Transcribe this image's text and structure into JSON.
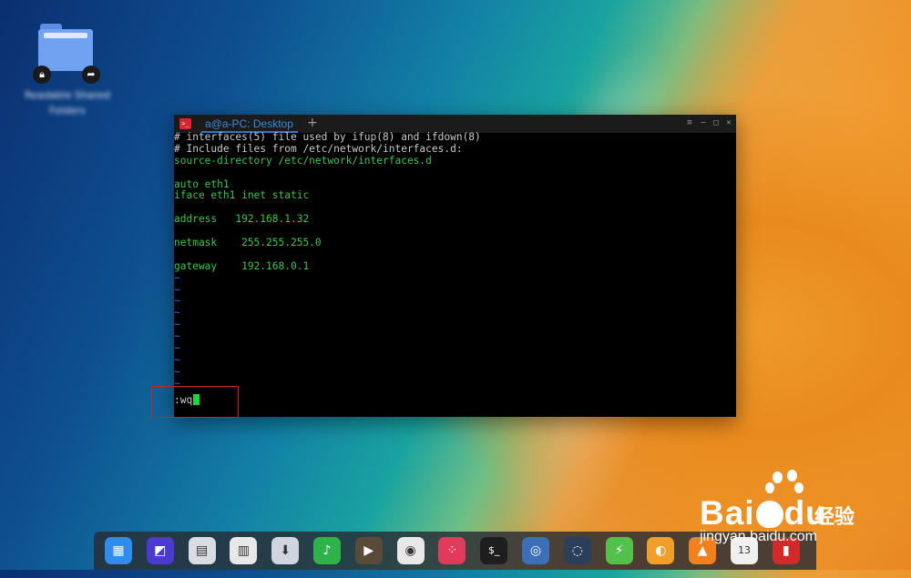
{
  "desktop": {
    "icon_label": "Readable Shared Folders"
  },
  "terminal": {
    "title": "a@a-PC: Desktop",
    "new_tab": "+",
    "win_menu": "≡",
    "win_min": "—",
    "win_max": "□",
    "win_close": "✕",
    "app_icon_glyph": ">_",
    "lines": [
      {
        "text": "# interfaces(5) file used by ifup(8) and ifdown(8)",
        "style": "comment"
      },
      {
        "text": "# Include files from /etc/network/interfaces.d:",
        "style": "comment"
      },
      {
        "text": "source-directory /etc/network/interfaces.d",
        "style": "green"
      },
      {
        "text": "",
        "style": "green"
      },
      {
        "text": "auto eth1",
        "style": "green"
      },
      {
        "text": "iface eth1 inet static",
        "style": "green"
      },
      {
        "text": "",
        "style": "green"
      },
      {
        "text": "address   192.168.1.32",
        "style": "green"
      },
      {
        "text": "",
        "style": "green"
      },
      {
        "text": "netmask    255.255.255.0",
        "style": "green"
      },
      {
        "text": "",
        "style": "green"
      },
      {
        "text": "gateway    192.168.0.1",
        "style": "green"
      },
      {
        "text": "~",
        "style": "tilde"
      },
      {
        "text": "~",
        "style": "tilde"
      },
      {
        "text": "~",
        "style": "tilde"
      },
      {
        "text": "~",
        "style": "tilde"
      },
      {
        "text": "~",
        "style": "tilde"
      },
      {
        "text": "~",
        "style": "tilde"
      },
      {
        "text": "~",
        "style": "tilde"
      },
      {
        "text": "~",
        "style": "tilde"
      },
      {
        "text": "~",
        "style": "tilde"
      },
      {
        "text": "~",
        "style": "tilde"
      }
    ],
    "command": ":wq"
  },
  "dock": {
    "items": [
      {
        "name": "launcher-icon",
        "glyph": "▦",
        "bg": "#2f8df0"
      },
      {
        "name": "multitasking-icon",
        "glyph": "◩",
        "bg": "#4a3ad0"
      },
      {
        "name": "file-manager-icon",
        "glyph": "▤",
        "bg": "#d8dde4"
      },
      {
        "name": "archive-manager-icon",
        "glyph": "▥",
        "bg": "#e8e8e8"
      },
      {
        "name": "app-store-icon",
        "glyph": "⬇",
        "bg": "#cfd6df"
      },
      {
        "name": "music-icon",
        "glyph": "♪",
        "bg": "#2fb24a"
      },
      {
        "name": "video-icon",
        "glyph": "▶",
        "bg": "#5a4a3a"
      },
      {
        "name": "chrome-icon",
        "glyph": "◉",
        "bg": "#e8e8e8"
      },
      {
        "name": "dice-app-icon",
        "glyph": "⁘",
        "bg": "#e23a5a"
      },
      {
        "name": "terminal-icon",
        "glyph": "$_",
        "bg": "#1e1e1e"
      },
      {
        "name": "screenshot-icon",
        "glyph": "◎",
        "bg": "#3b6fb8"
      },
      {
        "name": "browser-icon",
        "glyph": "◌",
        "bg": "#2c3f5a"
      },
      {
        "name": "thunder-icon",
        "glyph": "⚡",
        "bg": "#53c04a"
      },
      {
        "name": "sync-icon",
        "glyph": "◐",
        "bg": "#f0a02a"
      },
      {
        "name": "vlc-icon",
        "glyph": "▲",
        "bg": "#f08020"
      },
      {
        "name": "clock-icon",
        "glyph": "13",
        "bg": "#f0f0f0"
      },
      {
        "name": "trash-icon",
        "glyph": "▮",
        "bg": "#d02a2a"
      }
    ]
  },
  "watermark": {
    "brand": "Bai",
    "brand_tail": "du",
    "brand_cn": "经验",
    "url": "jingyan.baidu.com"
  }
}
